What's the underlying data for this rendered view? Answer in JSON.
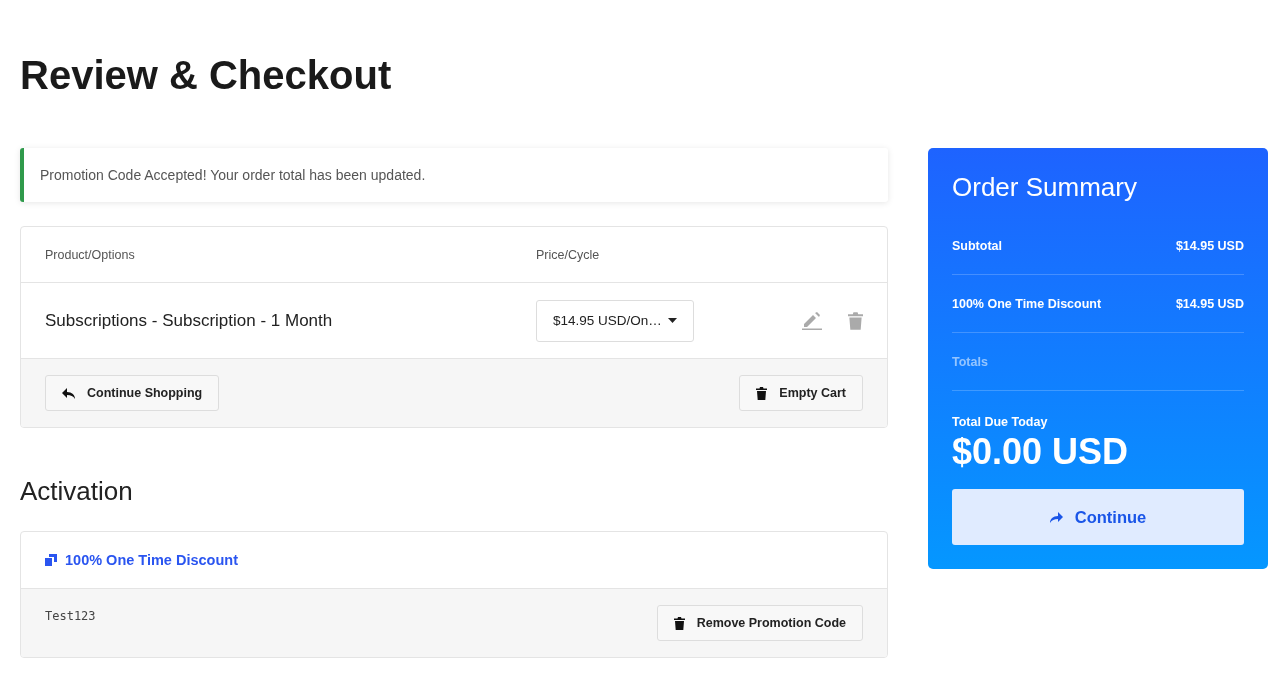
{
  "page_title": "Review & Checkout",
  "alert": {
    "message": "Promotion Code Accepted! Your order total has been updated."
  },
  "cart": {
    "columns": [
      "Product/Options",
      "Price/Cycle"
    ],
    "items": [
      {
        "name": "Subscriptions - Subscription - 1 Month",
        "price_select": "$14.95 USD/On…"
      }
    ],
    "continue_button": "Continue Shopping",
    "empty_button": "Empty Cart"
  },
  "activation": {
    "heading": "Activation",
    "promo_title": "100% One Time Discount",
    "promo_code": "Test123",
    "remove_button": "Remove Promotion Code"
  },
  "summary": {
    "title": "Order Summary",
    "lines": [
      {
        "kind": "line",
        "label": "Subtotal",
        "value": "$14.95 USD"
      },
      {
        "kind": "line",
        "label": "100% One Time Discount",
        "value": "$14.95 USD"
      },
      {
        "kind": "heading",
        "label": "Totals"
      }
    ],
    "due_label": "Total Due Today",
    "due_amount": "$0.00 USD",
    "continue_button": "Continue"
  }
}
